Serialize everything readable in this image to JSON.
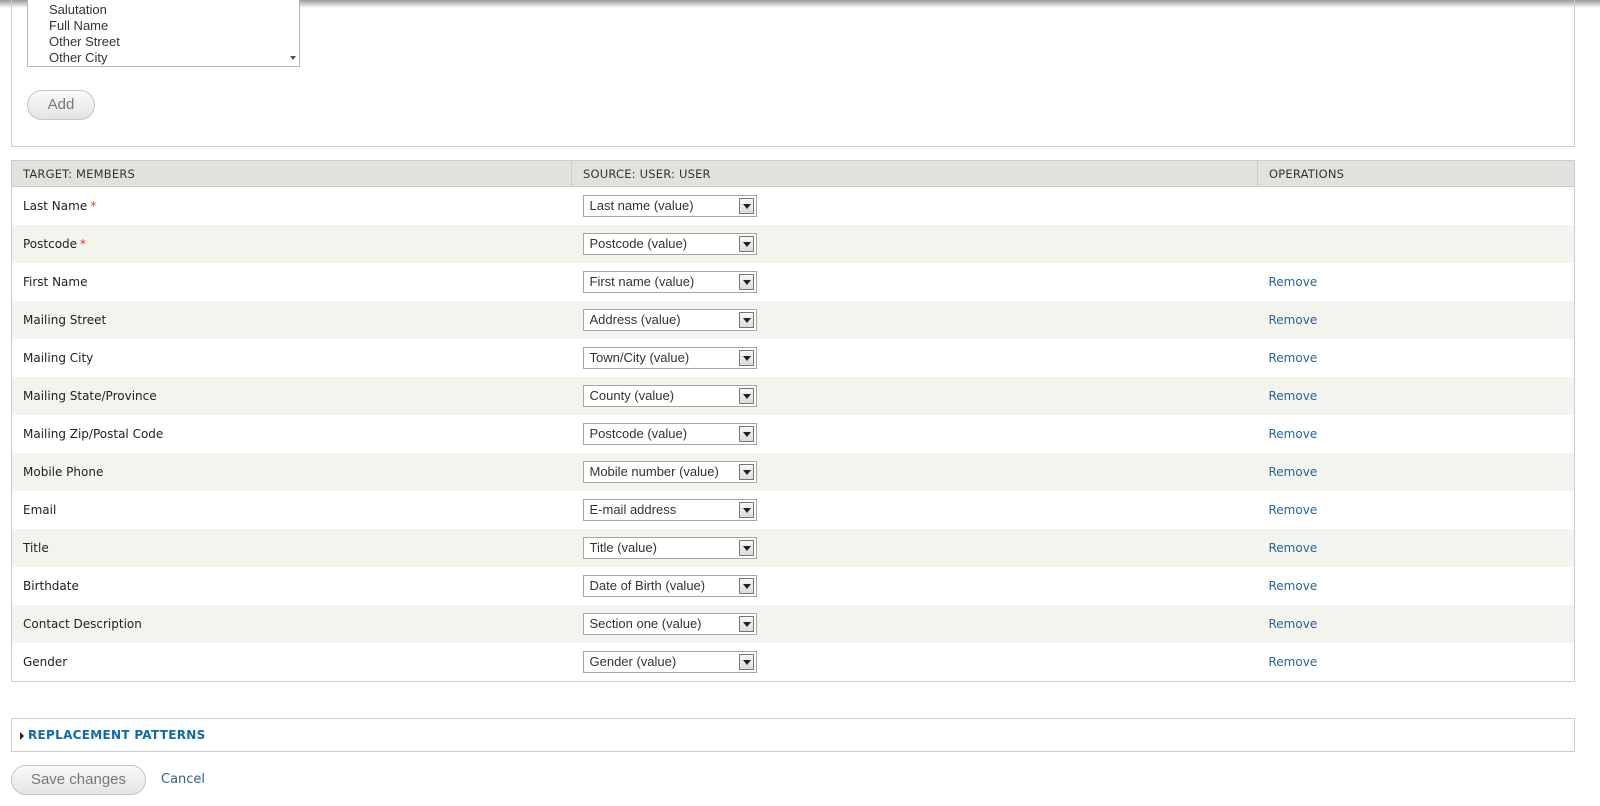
{
  "source_list": {
    "options": [
      "Salutation",
      "Full Name",
      "Other Street",
      "Other City"
    ]
  },
  "add_label": "Add",
  "table": {
    "headers": [
      "TARGET: MEMBERS",
      "SOURCE: USER: USER",
      "OPERATIONS"
    ],
    "rows": [
      {
        "target": "Last Name",
        "required": "*",
        "source": "Last name (value)",
        "op": ""
      },
      {
        "target": "Postcode",
        "required": "*",
        "source": "Postcode (value)",
        "op": ""
      },
      {
        "target": "First Name",
        "required": "",
        "source": "First name (value)",
        "op": "Remove"
      },
      {
        "target": "Mailing Street",
        "required": "",
        "source": "Address (value)",
        "op": "Remove"
      },
      {
        "target": "Mailing City",
        "required": "",
        "source": "Town/City (value)",
        "op": "Remove"
      },
      {
        "target": "Mailing State/Province",
        "required": "",
        "source": "County (value)",
        "op": "Remove"
      },
      {
        "target": "Mailing Zip/Postal Code",
        "required": "",
        "source": "Postcode (value)",
        "op": "Remove"
      },
      {
        "target": "Mobile Phone",
        "required": "",
        "source": "Mobile number (value)",
        "op": "Remove"
      },
      {
        "target": "Email",
        "required": "",
        "source": "E-mail address",
        "op": "Remove"
      },
      {
        "target": "Title",
        "required": "",
        "source": "Title (value)",
        "op": "Remove"
      },
      {
        "target": "Birthdate",
        "required": "",
        "source": "Date of Birth (value)",
        "op": "Remove"
      },
      {
        "target": "Contact Description",
        "required": "",
        "source": "Section one (value)",
        "op": "Remove"
      },
      {
        "target": "Gender",
        "required": "",
        "source": "Gender (value)",
        "op": "Remove"
      }
    ]
  },
  "replacement_patterns_label": "REPLACEMENT PATTERNS",
  "save_label": "Save changes",
  "cancel_label": "Cancel"
}
